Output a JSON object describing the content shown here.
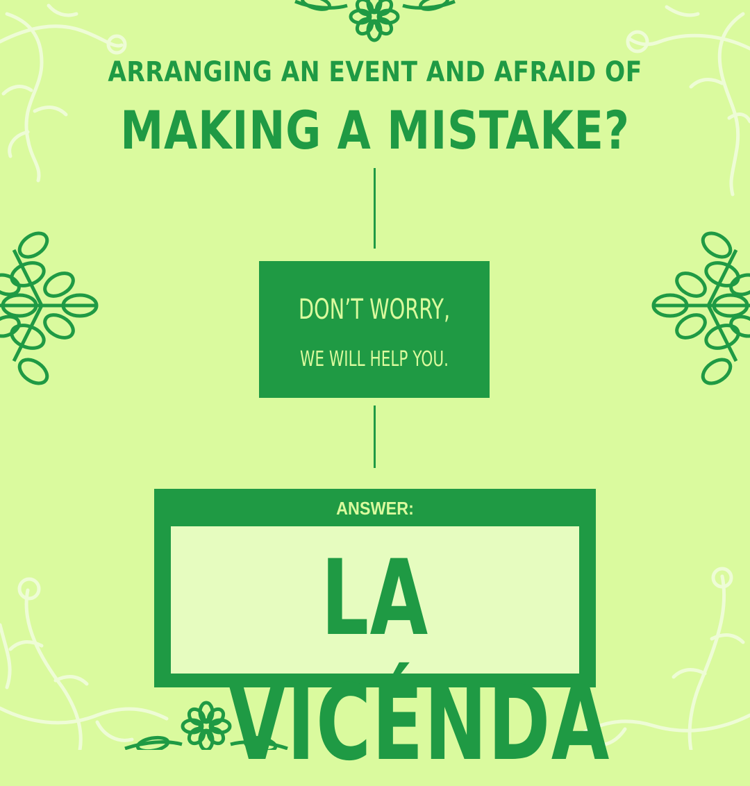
{
  "headline": {
    "line1": "ARRANGING AN EVENT AND AFRAID OF",
    "line2": "MAKING A MISTAKE?"
  },
  "message": {
    "line1": "DON’T WORRY,",
    "line2": "WE WILL HELP YOU."
  },
  "answer": {
    "label": "ANSWER:",
    "value": "LA VICÉNDA"
  },
  "colors": {
    "background": "#dafa9e",
    "primary_green": "#1f9a44",
    "light_panel": "#e6fcbf",
    "pale_vine": "#eefcd6"
  }
}
